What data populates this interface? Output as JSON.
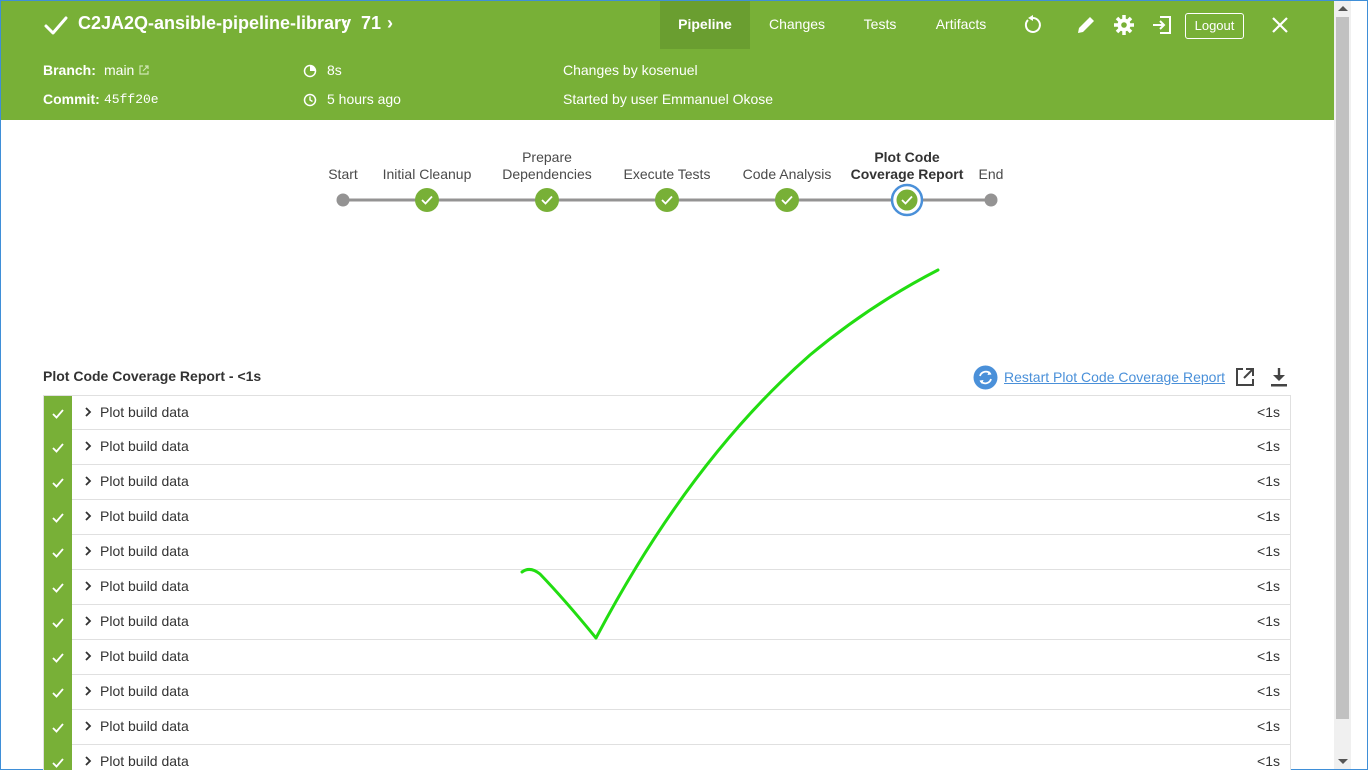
{
  "header": {
    "title": "C2JA2Q-ansible-pipeline-library",
    "run_number": "71",
    "tabs": [
      {
        "label": "Pipeline",
        "active": true
      },
      {
        "label": "Changes",
        "active": false
      },
      {
        "label": "Tests",
        "active": false
      },
      {
        "label": "Artifacts",
        "active": false
      }
    ],
    "logout_label": "Logout",
    "icons": [
      "replay-icon",
      "edit-icon",
      "gear-icon",
      "exit-icon",
      "close-icon"
    ],
    "color": "#78b037"
  },
  "meta": {
    "branch_label": "Branch:",
    "branch_value": "main",
    "commit_label": "Commit:",
    "commit_value": "45ff20e",
    "duration": "8s",
    "started_ago": "5 hours ago",
    "changes_by": "Changes by kosenuel",
    "started_by": "Started by user Emmanuel Okose"
  },
  "pipeline": {
    "stages": [
      {
        "label": "Start",
        "type": "endpoint"
      },
      {
        "label": "Initial Cleanup",
        "type": "success"
      },
      {
        "label": "Prepare Dependencies",
        "type": "success"
      },
      {
        "label": "Execute Tests",
        "type": "success"
      },
      {
        "label": "Code Analysis",
        "type": "success"
      },
      {
        "label": "Plot Code Coverage Report",
        "type": "success",
        "selected": true
      },
      {
        "label": "End",
        "type": "endpoint"
      }
    ]
  },
  "steps_panel": {
    "title": "Plot Code Coverage Report - <1s",
    "restart_label": "Restart Plot Code Coverage Report",
    "steps": [
      {
        "name": "Plot build data",
        "time": "<1s"
      },
      {
        "name": "Plot build data",
        "time": "<1s"
      },
      {
        "name": "Plot build data",
        "time": "<1s"
      },
      {
        "name": "Plot build data",
        "time": "<1s"
      },
      {
        "name": "Plot build data",
        "time": "<1s"
      },
      {
        "name": "Plot build data",
        "time": "<1s"
      },
      {
        "name": "Plot build data",
        "time": "<1s"
      },
      {
        "name": "Plot build data",
        "time": "<1s"
      },
      {
        "name": "Plot build data",
        "time": "<1s"
      },
      {
        "name": "Plot build data",
        "time": "<1s"
      },
      {
        "name": "Plot build data",
        "time": "<1s"
      }
    ]
  },
  "colors": {
    "success": "#78b037",
    "link": "#4a90d9",
    "annotation": "#22dd11"
  }
}
